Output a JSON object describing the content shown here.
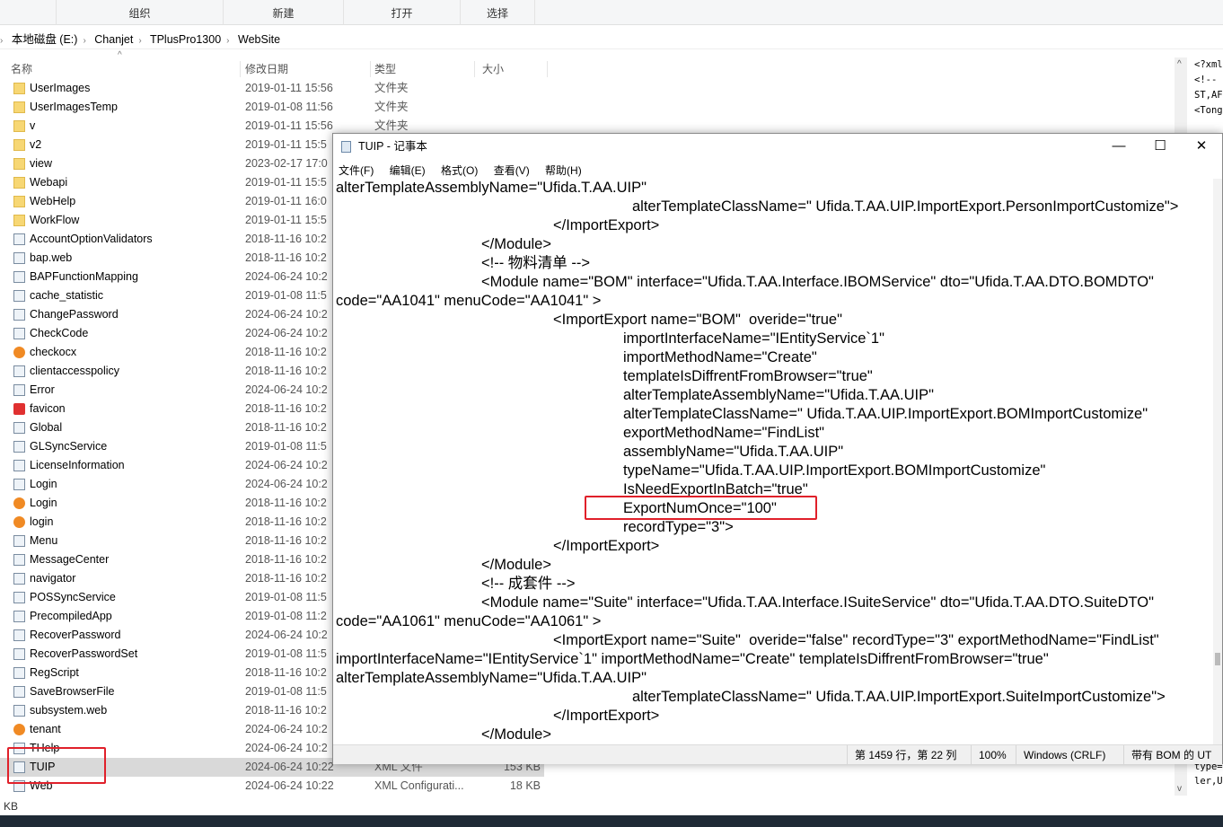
{
  "ribbon": {
    "tabs": [
      "组织",
      "新建",
      "打开",
      "选择"
    ]
  },
  "breadcrumb": [
    "本地磁盘 (E:)",
    "Chanjet",
    "TPlusPro1300",
    "WebSite"
  ],
  "columns": {
    "name": "名称",
    "date": "修改日期",
    "type": "类型",
    "size": "大小"
  },
  "files": [
    {
      "name": "UserImages",
      "date": "2019-01-11 15:56",
      "type": "文件夹",
      "icon": "folder"
    },
    {
      "name": "UserImagesTemp",
      "date": "2019-01-08 11:56",
      "type": "文件夹",
      "icon": "folder"
    },
    {
      "name": "v",
      "date": "2019-01-11 15:56",
      "type": "文件夹",
      "icon": "folder"
    },
    {
      "name": "v2",
      "date": "2019-01-11 15:5",
      "icon": "folder"
    },
    {
      "name": "view",
      "date": "2023-02-17 17:0",
      "icon": "folder"
    },
    {
      "name": "Webapi",
      "date": "2019-01-11 15:5",
      "icon": "folder"
    },
    {
      "name": "WebHelp",
      "date": "2019-01-11 16:0",
      "icon": "folder"
    },
    {
      "name": "WorkFlow",
      "date": "2019-01-11 15:5",
      "icon": "folder"
    },
    {
      "name": "AccountOptionValidators",
      "date": "2018-11-16 10:2",
      "icon": "file"
    },
    {
      "name": "bap.web",
      "date": "2018-11-16 10:2",
      "icon": "file"
    },
    {
      "name": "BAPFunctionMapping",
      "date": "2024-06-24 10:2",
      "icon": "file"
    },
    {
      "name": "cache_statistic",
      "date": "2019-01-08 11:5",
      "icon": "file"
    },
    {
      "name": "ChangePassword",
      "date": "2024-06-24 10:2",
      "icon": "file"
    },
    {
      "name": "CheckCode",
      "date": "2024-06-24 10:2",
      "icon": "file"
    },
    {
      "name": "checkocx",
      "date": "2018-11-16 10:2",
      "icon": "orange"
    },
    {
      "name": "clientaccesspolicy",
      "date": "2018-11-16 10:2",
      "icon": "file"
    },
    {
      "name": "Error",
      "date": "2024-06-24 10:2",
      "icon": "file"
    },
    {
      "name": "favicon",
      "date": "2018-11-16 10:2",
      "icon": "favicon"
    },
    {
      "name": "Global",
      "date": "2018-11-16 10:2",
      "icon": "file"
    },
    {
      "name": "GLSyncService",
      "date": "2019-01-08 11:5",
      "icon": "file"
    },
    {
      "name": "LicenseInformation",
      "date": "2024-06-24 10:2",
      "icon": "file"
    },
    {
      "name": "Login",
      "date": "2024-06-24 10:2",
      "icon": "file"
    },
    {
      "name": "Login",
      "date": "2018-11-16 10:2",
      "icon": "orange"
    },
    {
      "name": "login",
      "date": "2018-11-16 10:2",
      "icon": "orange"
    },
    {
      "name": "Menu",
      "date": "2018-11-16 10:2",
      "icon": "file"
    },
    {
      "name": "MessageCenter",
      "date": "2018-11-16 10:2",
      "icon": "file"
    },
    {
      "name": "navigator",
      "date": "2018-11-16 10:2",
      "icon": "file"
    },
    {
      "name": "POSSyncService",
      "date": "2019-01-08 11:5",
      "icon": "file"
    },
    {
      "name": "PrecompiledApp",
      "date": "2019-01-08 11:2",
      "icon": "file"
    },
    {
      "name": "RecoverPassword",
      "date": "2024-06-24 10:2",
      "icon": "file"
    },
    {
      "name": "RecoverPasswordSet",
      "date": "2019-01-08 11:5",
      "icon": "file"
    },
    {
      "name": "RegScript",
      "date": "2018-11-16 10:2",
      "icon": "file"
    },
    {
      "name": "SaveBrowserFile",
      "date": "2019-01-08 11:5",
      "icon": "file"
    },
    {
      "name": "subsystem.web",
      "date": "2018-11-16 10:2",
      "icon": "file"
    },
    {
      "name": "tenant",
      "date": "2024-06-24 10:2",
      "icon": "orange"
    },
    {
      "name": "THelp",
      "date": "2024-06-24 10:2",
      "icon": "file"
    },
    {
      "name": "TUIP",
      "date": "2024-06-24 10:22",
      "type": "XML 文件",
      "size": "153 KB",
      "icon": "file",
      "selected": true
    },
    {
      "name": "Web",
      "date": "2024-06-24 10:22",
      "type": "XML Configurati...",
      "size": "18 KB",
      "icon": "file"
    }
  ],
  "status_left": "KB",
  "right_pane_lines": [
    "<?xml",
    "<!--",
    "ST,AF",
    "<Tong",
    "type=",
    "ler,U"
  ],
  "notepad": {
    "title": "TUIP - 记事本",
    "menu": [
      "文件(F)",
      "编辑(E)",
      "格式(O)",
      "查看(V)",
      "帮助(H)"
    ],
    "lines": [
      {
        "i": 0,
        "t": "alterTemplateAssemblyName=\"Ufida.T.AA.UIP\""
      },
      {
        "i": 4,
        "t": "alterTemplateClassName=\" Ufida.T.AA.UIP.ImportExport.PersonImportCustomize\">"
      },
      {
        "i": 2,
        "t": "</ImportExport>"
      },
      {
        "i": 1,
        "t": "</Module>"
      },
      {
        "i": 1,
        "t": "<!-- 物料清单 -->"
      },
      {
        "i": 1,
        "t": "<Module name=\"BOM\" interface=\"Ufida.T.AA.Interface.IBOMService\" dto=\"Ufida.T.AA.DTO.BOMDTO\""
      },
      {
        "i": 0,
        "t": "code=\"AA1041\" menuCode=\"AA1041\" >"
      },
      {
        "i": 2,
        "t": "<ImportExport name=\"BOM\"  overide=\"true\""
      },
      {
        "i": 3,
        "t": "importInterfaceName=\"IEntityService`1\""
      },
      {
        "i": 3,
        "t": "importMethodName=\"Create\""
      },
      {
        "i": 3,
        "t": "templateIsDiffrentFromBrowser=\"true\""
      },
      {
        "i": 3,
        "t": "alterTemplateAssemblyName=\"Ufida.T.AA.UIP\""
      },
      {
        "i": 3,
        "t": "alterTemplateClassName=\" Ufida.T.AA.UIP.ImportExport.BOMImportCustomize\""
      },
      {
        "i": 3,
        "t": "exportMethodName=\"FindList\""
      },
      {
        "i": 3,
        "t": "assemblyName=\"Ufida.T.AA.UIP\""
      },
      {
        "i": 3,
        "t": "typeName=\"Ufida.T.AA.UIP.ImportExport.BOMImportCustomize\""
      },
      {
        "i": 3,
        "t": "IsNeedExportInBatch=\"true\""
      },
      {
        "i": 3,
        "t": "ExportNumOnce=\"100\""
      },
      {
        "i": 3,
        "t": "recordType=\"3\">"
      },
      {
        "i": 2,
        "t": "</ImportExport>"
      },
      {
        "i": 1,
        "t": "</Module>"
      },
      {
        "i": 1,
        "t": "<!-- 成套件 -->"
      },
      {
        "i": 1,
        "t": "<Module name=\"Suite\" interface=\"Ufida.T.AA.Interface.ISuiteService\" dto=\"Ufida.T.AA.DTO.SuiteDTO\""
      },
      {
        "i": 0,
        "t": "code=\"AA1061\" menuCode=\"AA1061\" >"
      },
      {
        "i": 2,
        "t": "<ImportExport name=\"Suite\"  overide=\"false\" recordType=\"3\" exportMethodName=\"FindList\""
      },
      {
        "i": 0,
        "t": "importInterfaceName=\"IEntityService`1\" importMethodName=\"Create\" templateIsDiffrentFromBrowser=\"true\""
      },
      {
        "i": 0,
        "t": "alterTemplateAssemblyName=\"Ufida.T.AA.UIP\""
      },
      {
        "i": 4,
        "t": "alterTemplateClassName=\" Ufida.T.AA.UIP.ImportExport.SuiteImportCustomize\">"
      },
      {
        "i": 2,
        "t": "</ImportExport>"
      },
      {
        "i": 1,
        "t": "</Module>"
      }
    ],
    "status": {
      "position": "第 1459 行，第 22 列",
      "zoom": "100%",
      "line_ending": "Windows (CRLF)",
      "encoding": "带有 BOM 的 UT"
    },
    "window_buttons": {
      "minimize": "—",
      "maximize": "☐",
      "close": "✕"
    }
  },
  "colors": {
    "highlight": "#e0202a",
    "selected_row": "#d9d9d9",
    "taskbar": "#1f2a36"
  }
}
